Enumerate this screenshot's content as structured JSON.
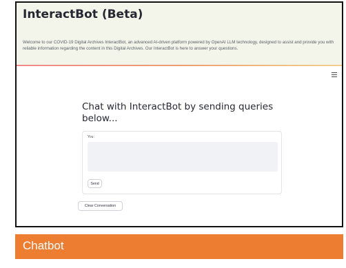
{
  "app": {
    "title": "InteractBot (Beta)",
    "welcome_text": "Welcome to our COVID-19 Digital Archives InteractBot, an advanced AI-driven platform powered by OpenAI LLM technology, designed to assist and provide you with reliable information regarding the content in this Digital Archives. Our InteractBot is here to answer your questions."
  },
  "menu": {
    "icon": "hamburger-menu-icon"
  },
  "chat": {
    "heading": "Chat with InteractBot by sending queries below...",
    "input_label": "You:",
    "input_value": "",
    "send_label": "Send",
    "clear_label": "Clear Conversation"
  },
  "caption": {
    "text": "Chatbot"
  },
  "colors": {
    "header_bg": "#f3f5ea",
    "caption_bg": "#ed7d31",
    "textarea_bg": "#f0f2f6"
  }
}
